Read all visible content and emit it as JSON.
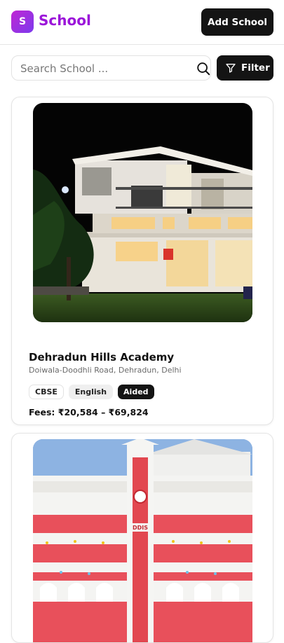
{
  "header": {
    "logo_letter": "S",
    "brand": "School",
    "add_button": "Add School"
  },
  "search": {
    "placeholder": "Search School ...",
    "value": "",
    "filter_label": "Filter"
  },
  "schools": [
    {
      "name": "Dehradun Hills Academy",
      "address": "Doiwala-Doodhli Road, Dehradun, Delhi",
      "tags": [
        "CBSE",
        "English",
        "Aided"
      ],
      "fees": "Fees: ₹20,584 – ₹69,824"
    },
    {
      "image_sign": "DDIS"
    }
  ],
  "colors": {
    "brand": "#9b16d9",
    "dark": "#141414",
    "school_building_2": "#e8505b"
  }
}
